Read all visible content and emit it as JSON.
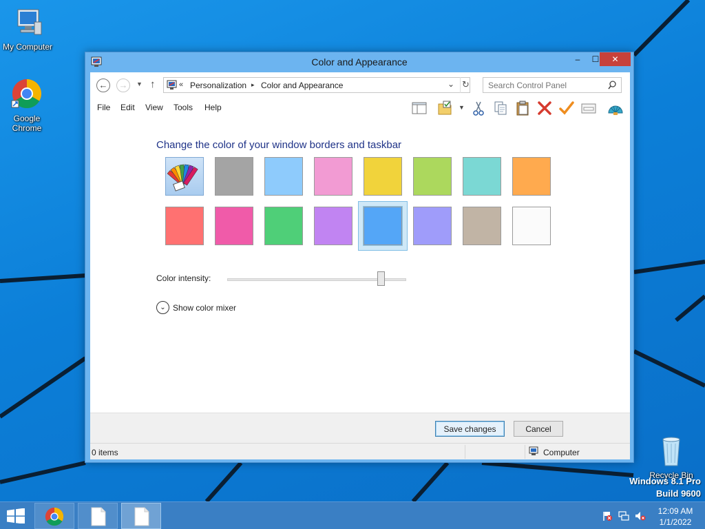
{
  "desktop": {
    "icons": [
      {
        "label": "My Computer",
        "icon": "computer-icon"
      },
      {
        "label": "Google\nChrome",
        "icon": "chrome-icon"
      },
      {
        "label": "Recycle Bin",
        "icon": "recycle-bin-icon"
      }
    ],
    "watermark": {
      "line1": "Windows 8.1 Pro",
      "line2": "Build 9600"
    }
  },
  "window": {
    "title": "Color and Appearance",
    "controls": {
      "minimize": "‒",
      "maximize": "☐",
      "close": "✕"
    },
    "address": {
      "separator": "«",
      "crumbs": [
        "Personalization",
        "Color and Appearance"
      ]
    },
    "search": {
      "placeholder": "Search Control Panel"
    },
    "menu": [
      "File",
      "Edit",
      "View",
      "Tools",
      "Help"
    ],
    "toolbar_icons": [
      "preview-pane-icon",
      "folder-check-icon",
      "dropdown-icon",
      "cut-icon",
      "copy-icon",
      "paste-icon",
      "delete-icon",
      "checkmark-icon",
      "properties-icon",
      "shell-icon"
    ],
    "content": {
      "heading": "Change the color of your window borders and taskbar",
      "swatches": [
        {
          "name": "custom-palette",
          "color": "palette"
        },
        {
          "name": "gray",
          "color": "#a4a4a4"
        },
        {
          "name": "light-blue",
          "color": "#8ecbfc"
        },
        {
          "name": "pink",
          "color": "#f29bd3"
        },
        {
          "name": "yellow",
          "color": "#f1d33b"
        },
        {
          "name": "lime",
          "color": "#acd85d"
        },
        {
          "name": "teal",
          "color": "#7bd8d4"
        },
        {
          "name": "orange",
          "color": "#ffaa4e"
        },
        {
          "name": "red",
          "color": "#ff7171"
        },
        {
          "name": "magenta",
          "color": "#f05ba9"
        },
        {
          "name": "green",
          "color": "#4fcf78"
        },
        {
          "name": "purple",
          "color": "#c184f2"
        },
        {
          "name": "blue",
          "color": "#54a6f7",
          "selected": true
        },
        {
          "name": "periwinkle",
          "color": "#9f9cfa"
        },
        {
          "name": "taupe",
          "color": "#c1b4a5"
        },
        {
          "name": "white",
          "color": "#fbfbfb"
        }
      ],
      "intensity_label": "Color intensity:",
      "intensity_value": 0.86,
      "mixer_label": "Show color mixer"
    },
    "buttons": {
      "save": "Save changes",
      "cancel": "Cancel"
    },
    "status": {
      "items": "0 items",
      "location": "Computer"
    }
  },
  "taskbar": {
    "apps": [
      "chrome-icon",
      "document-icon",
      "document-icon"
    ],
    "tray_icons": [
      "action-center-flag-icon",
      "network-icon",
      "volume-muted-icon"
    ],
    "clock": {
      "time": "12:09 AM",
      "date": "1/1/2022"
    }
  }
}
